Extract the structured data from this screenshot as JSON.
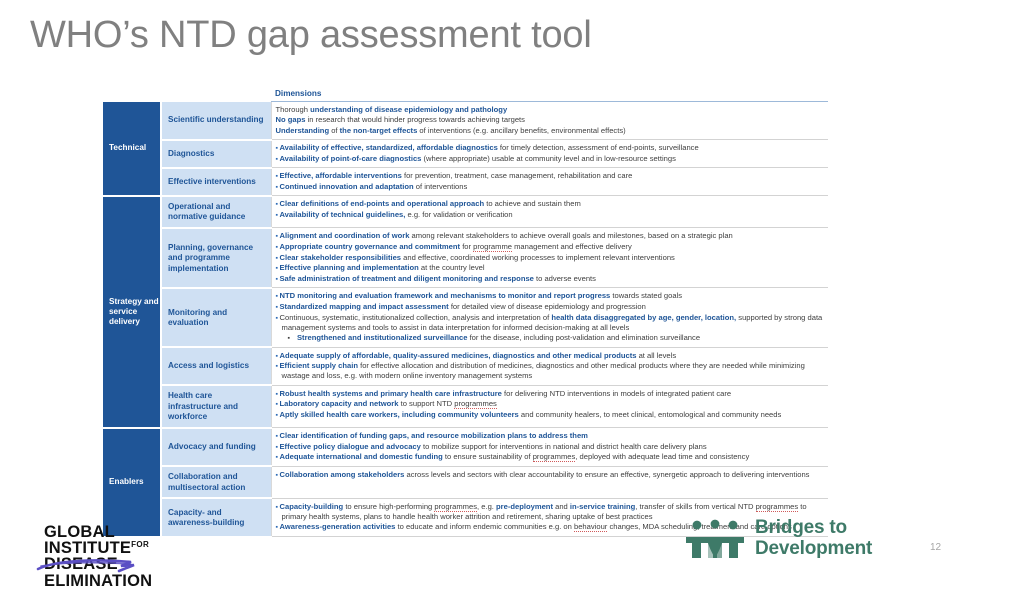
{
  "slide": {
    "title": "WHO’s NTD gap assessment tool",
    "page_number": "12"
  },
  "colors": {
    "category_bg": "#1F5597",
    "dimension_bg": "#CFE0F3",
    "accent_blue": "#1F5597",
    "bullet_blue": "#2E6BB5",
    "title_gray": "#808080",
    "b2d_green": "#3E7A68",
    "gide_swoosh": "#5B4FC4"
  },
  "table": {
    "header": {
      "col1": "",
      "col2": "",
      "col3": "Dimensions"
    },
    "groups": [
      {
        "category": "Technical",
        "rows": [
          {
            "dimension": "Scientific understanding",
            "lines": [
              {
                "bullet": "none",
                "parts": [
                  {
                    "t": "Thorough ",
                    "hl": false
                  },
                  {
                    "t": "understanding of disease epidemiology and pathology",
                    "hl": true
                  }
                ]
              },
              {
                "bullet": "none",
                "parts": [
                  {
                    "t": "No gaps",
                    "hl": true
                  },
                  {
                    "t": " in research that would hinder progress towards achieving targets",
                    "hl": false
                  }
                ]
              },
              {
                "bullet": "none",
                "parts": [
                  {
                    "t": "Understanding",
                    "hl": true
                  },
                  {
                    "t": " of ",
                    "hl": false
                  },
                  {
                    "t": "the non-target effects",
                    "hl": true
                  },
                  {
                    "t": " of interventions (e.g. ancillary benefits, environmental effects)",
                    "hl": false
                  }
                ]
              }
            ]
          },
          {
            "dimension": "Diagnostics",
            "lines": [
              {
                "bullet": "square",
                "parts": [
                  {
                    "t": "Availability of effective, standardized, affordable diagnostics",
                    "hl": true
                  },
                  {
                    "t": " for timely detection, assessment of end-points, surveillance",
                    "hl": false
                  }
                ]
              },
              {
                "bullet": "square",
                "parts": [
                  {
                    "t": "Availability of point-of-care diagnostics",
                    "hl": true
                  },
                  {
                    "t": " (where appropriate) usable at community level and in low-resource settings",
                    "hl": false
                  }
                ]
              }
            ]
          },
          {
            "dimension": "Effective interventions",
            "lines": [
              {
                "bullet": "square",
                "parts": [
                  {
                    "t": "Effective, affordable interventions",
                    "hl": true
                  },
                  {
                    "t": " for prevention, treatment, case management, rehabilitation and care",
                    "hl": false
                  }
                ]
              },
              {
                "bullet": "square",
                "parts": [
                  {
                    "t": "Continued innovation and adaptation",
                    "hl": true
                  },
                  {
                    "t": " of interventions",
                    "hl": false
                  }
                ]
              }
            ]
          }
        ]
      },
      {
        "category": "Strategy and service delivery",
        "rows": [
          {
            "dimension": "Operational and normative guidance",
            "lines": [
              {
                "bullet": "square",
                "parts": [
                  {
                    "t": "Clear definitions of end-points and operational approach",
                    "hl": true
                  },
                  {
                    "t": " to achieve and sustain them",
                    "hl": false
                  }
                ]
              },
              {
                "bullet": "square",
                "parts": [
                  {
                    "t": "Availability of technical guidelines,",
                    "hl": true
                  },
                  {
                    "t": " e.g. for validation or verification",
                    "hl": false
                  }
                ]
              }
            ]
          },
          {
            "dimension": "Planning, governance and programme implementation",
            "lines": [
              {
                "bullet": "square",
                "parts": [
                  {
                    "t": "Alignment and coordination of work",
                    "hl": true
                  },
                  {
                    "t": " among relevant stakeholders to achieve overall goals and milestones, based on a strategic plan",
                    "hl": false
                  }
                ]
              },
              {
                "bullet": "square",
                "parts": [
                  {
                    "t": "Appropriate country governance and commitment",
                    "hl": true
                  },
                  {
                    "t": " for ",
                    "hl": false
                  },
                  {
                    "t": "programme",
                    "hl": false,
                    "redline": true
                  },
                  {
                    "t": " management and effective delivery",
                    "hl": false
                  }
                ]
              },
              {
                "bullet": "square",
                "parts": [
                  {
                    "t": "Clear stakeholder responsibilities",
                    "hl": true
                  },
                  {
                    "t": " and effective, coordinated working processes to implement relevant interventions",
                    "hl": false
                  }
                ]
              },
              {
                "bullet": "square",
                "parts": [
                  {
                    "t": "Effective planning and implementation",
                    "hl": true
                  },
                  {
                    "t": " at the country level",
                    "hl": false
                  }
                ]
              },
              {
                "bullet": "square",
                "parts": [
                  {
                    "t": "Safe administration of treatment and diligent monitoring and response",
                    "hl": true
                  },
                  {
                    "t": " to adverse events",
                    "hl": false
                  }
                ]
              }
            ]
          },
          {
            "dimension": "Monitoring and evaluation",
            "lines": [
              {
                "bullet": "square",
                "parts": [
                  {
                    "t": "NTD monitoring and evaluation framework and mechanisms to monitor and report progress",
                    "hl": true
                  },
                  {
                    "t": " towards stated goals",
                    "hl": false
                  }
                ]
              },
              {
                "bullet": "square",
                "parts": [
                  {
                    "t": "Standardized mapping and impact assessment",
                    "hl": true
                  },
                  {
                    "t": " for detailed view of disease epidemiology and progression",
                    "hl": false
                  }
                ]
              },
              {
                "bullet": "square",
                "parts": [
                  {
                    "t": "Continuous, systematic, institutionalized collection, analysis and interpretation of ",
                    "hl": false
                  },
                  {
                    "t": "health data disaggregated by age, gender, location,",
                    "hl": true
                  },
                  {
                    "t": " supported by strong data management systems and tools to assist in data interpretation for informed decision-making at all levels",
                    "hl": false
                  }
                ]
              },
              {
                "bullet": "indent",
                "parts": [
                  {
                    "t": "Strengthened and institutionalized surveillance",
                    "hl": true
                  },
                  {
                    "t": " for the disease, including post-validation and elimination surveillance",
                    "hl": false
                  }
                ]
              }
            ]
          },
          {
            "dimension": "Access and logistics",
            "lines": [
              {
                "bullet": "square",
                "parts": [
                  {
                    "t": "Adequate supply of affordable, quality-assured medicines, diagnostics and other medical products",
                    "hl": true
                  },
                  {
                    "t": " at all levels",
                    "hl": false
                  }
                ]
              },
              {
                "bullet": "square",
                "parts": [
                  {
                    "t": "Efficient supply chain",
                    "hl": true
                  },
                  {
                    "t": " for effective allocation and distribution of medicines, diagnostics and other medical products where they are needed while minimizing wastage and loss, e.g. with modern online inventory management systems",
                    "hl": false
                  }
                ]
              }
            ]
          },
          {
            "dimension": "Health care infrastructure and workforce",
            "lines": [
              {
                "bullet": "square",
                "parts": [
                  {
                    "t": "Robust health systems and primary health care infrastructure",
                    "hl": true
                  },
                  {
                    "t": " for delivering NTD interventions in models of integrated patient care",
                    "hl": false
                  }
                ]
              },
              {
                "bullet": "square",
                "parts": [
                  {
                    "t": "Laboratory capacity and network",
                    "hl": true
                  },
                  {
                    "t": " to support NTD ",
                    "hl": false
                  },
                  {
                    "t": "programmes",
                    "hl": false,
                    "redline": true
                  }
                ]
              },
              {
                "bullet": "square",
                "parts": [
                  {
                    "t": "Aptly skilled health care workers, including community volunteers",
                    "hl": true
                  },
                  {
                    "t": " and community healers, to meet clinical, entomological and community needs",
                    "hl": false
                  }
                ]
              }
            ]
          }
        ]
      },
      {
        "category": "Enablers",
        "rows": [
          {
            "dimension": "Advocacy and funding",
            "lines": [
              {
                "bullet": "square",
                "parts": [
                  {
                    "t": "Clear identification of funding gaps, and resource mobilization plans to address them",
                    "hl": true
                  }
                ]
              },
              {
                "bullet": "square",
                "parts": [
                  {
                    "t": "Effective policy dialogue and advocacy",
                    "hl": true
                  },
                  {
                    "t": " to mobilize support for interventions in national and district health care delivery plans",
                    "hl": false
                  }
                ]
              },
              {
                "bullet": "square",
                "parts": [
                  {
                    "t": "Adequate international and domestic funding",
                    "hl": true
                  },
                  {
                    "t": " to ensure sustainability of ",
                    "hl": false
                  },
                  {
                    "t": "programmes",
                    "hl": false,
                    "redline": true
                  },
                  {
                    "t": ", deployed with adequate lead time and consistency",
                    "hl": false
                  }
                ]
              }
            ]
          },
          {
            "dimension": "Collaboration and multisectoral action",
            "lines": [
              {
                "bullet": "square",
                "parts": [
                  {
                    "t": "Collaboration among stakeholders",
                    "hl": true
                  },
                  {
                    "t": " across levels and sectors with clear accountability to ensure an effective, synergetic approach to delivering interventions",
                    "hl": false
                  }
                ]
              }
            ]
          },
          {
            "dimension": "Capacity- and awareness-building",
            "lines": [
              {
                "bullet": "square",
                "parts": [
                  {
                    "t": "Capacity-building",
                    "hl": true
                  },
                  {
                    "t": " to ensure high-performing ",
                    "hl": false
                  },
                  {
                    "t": "programmes",
                    "hl": false,
                    "redline": true
                  },
                  {
                    "t": ", e.g. ",
                    "hl": false
                  },
                  {
                    "t": "pre-deployment",
                    "hl": true
                  },
                  {
                    "t": " and ",
                    "hl": false
                  },
                  {
                    "t": "in-service training",
                    "hl": true
                  },
                  {
                    "t": ", transfer of skills from vertical NTD ",
                    "hl": false
                  },
                  {
                    "t": "programmes",
                    "hl": false,
                    "redline": true
                  },
                  {
                    "t": " to primary health systems, plans to handle health worker attrition and retirement, sharing uptake of best practices",
                    "hl": false
                  }
                ]
              },
              {
                "bullet": "square",
                "parts": [
                  {
                    "t": "Awareness-generation activities",
                    "hl": true
                  },
                  {
                    "t": " to educate and inform endemic communities e.g. on ",
                    "hl": false
                  },
                  {
                    "t": "behaviour",
                    "hl": false,
                    "redline": true
                  },
                  {
                    "t": " changes, MDA scheduling, treatment and care options",
                    "hl": false
                  }
                ]
              }
            ]
          }
        ]
      }
    ]
  },
  "footer": {
    "gide_logo": {
      "line1": "GLOBAL",
      "line2": "INSTITUTE",
      "line2_sup": "FOR",
      "line3": "DISEASE",
      "line4": "ELIMINATION"
    },
    "b2d_logo": {
      "line1": "Bridges to",
      "line2": "Development"
    }
  }
}
